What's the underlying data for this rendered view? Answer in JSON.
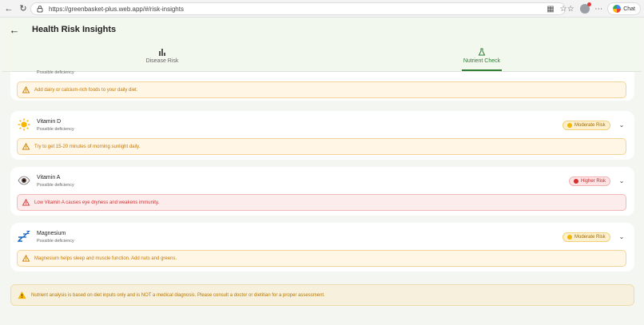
{
  "browser": {
    "url": "https://greenbasket-plus.web.app/#/risk-insights",
    "chat_label": "Chat"
  },
  "header": {
    "title": "Health Risk Insights",
    "tabs": [
      {
        "label": "Disease Risk",
        "icon": "bar-chart-icon",
        "active": false
      },
      {
        "label": "Nutrient Check",
        "icon": "flask-icon",
        "active": true
      }
    ]
  },
  "nutrients": [
    {
      "name": "",
      "subtitle": "Possible deficiency",
      "icon": "calcium-icon",
      "risk": "",
      "tip": "Add dairy or calcium-rich foods to your daily diet."
    },
    {
      "name": "Vitamin D",
      "subtitle": "Possible deficiency",
      "icon": "sun-icon",
      "risk": "Moderate Risk",
      "tip": "Try to get 15-20 minutes of morning sunlight daily."
    },
    {
      "name": "Vitamin A",
      "subtitle": "Possible deficiency",
      "icon": "eye-icon",
      "risk": "Higher Risk",
      "tip": "Low Vitamin A causes eye dryness and weakens immunity."
    },
    {
      "name": "Magnesium",
      "subtitle": "Possible deficiency",
      "icon": "sleep-zzz-icon",
      "risk": "Moderate Risk",
      "tip": "Magnesium helps sleep and muscle function. Add nuts and greens."
    }
  ],
  "disclaimer": "Nutrient analysis is based on diet inputs only and is NOT a medical diagnosis. Please consult a doctor or dietitian for a proper assessment.",
  "colors": {
    "accent_green": "#2e7d32",
    "moderate": "#f2b705",
    "high": "#d32f2f",
    "tip_amber": "#c77700"
  }
}
